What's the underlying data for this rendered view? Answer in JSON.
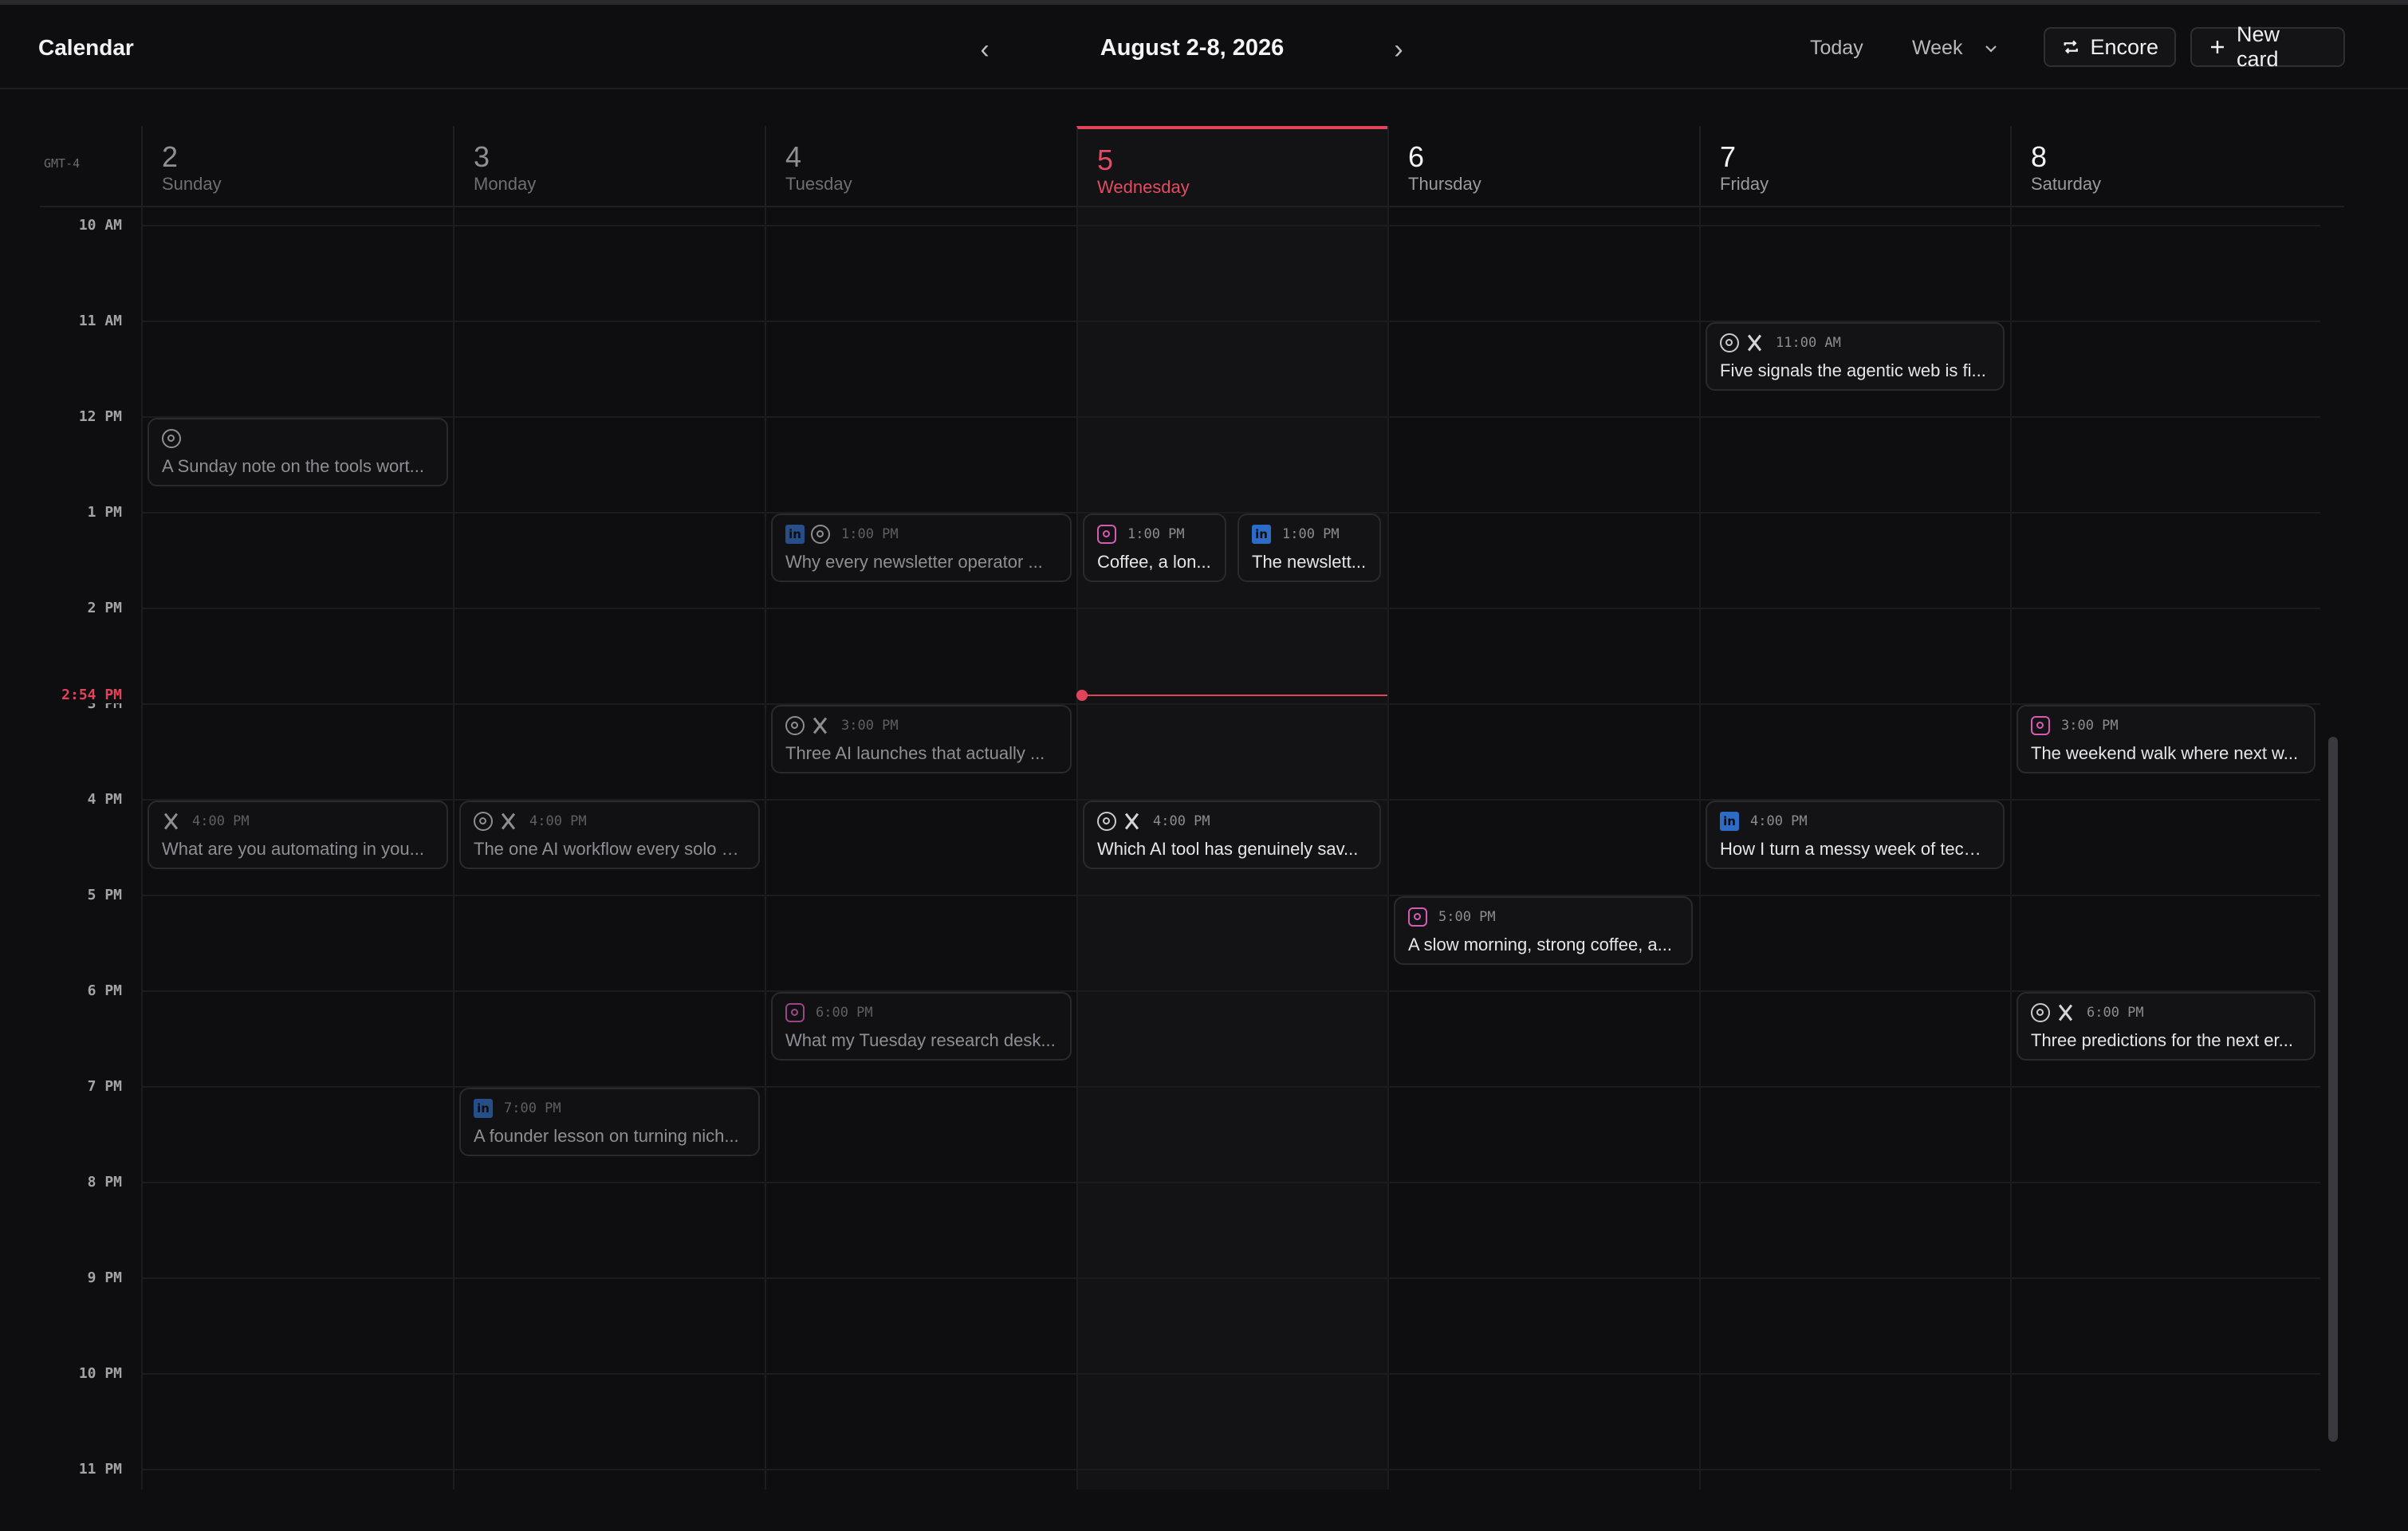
{
  "header": {
    "title": "Calendar",
    "range": "August 2-8, 2026",
    "prev_icon": "chevron-left-icon",
    "next_icon": "chevron-right-icon",
    "today_label": "Today",
    "view_label": "Week",
    "encore_label": "Encore",
    "new_card_label": "New card"
  },
  "timezone": "GMT-4",
  "days": [
    {
      "num": "2",
      "name": "Sunday"
    },
    {
      "num": "3",
      "name": "Monday"
    },
    {
      "num": "4",
      "name": "Tuesday"
    },
    {
      "num": "5",
      "name": "Wednesday"
    },
    {
      "num": "6",
      "name": "Thursday"
    },
    {
      "num": "7",
      "name": "Friday"
    },
    {
      "num": "8",
      "name": "Saturday"
    }
  ],
  "hours": [
    "10 AM",
    "11 AM",
    "12 PM",
    "1 PM",
    "2 PM",
    "3 PM",
    "4 PM",
    "5 PM",
    "6 PM",
    "7 PM",
    "8 PM",
    "9 PM",
    "10 PM",
    "11 PM"
  ],
  "now": "2:54 PM",
  "accent": "#e0435a",
  "events": [
    {
      "time": "",
      "title": "A Sunday note on the tools wort...",
      "platforms": [
        "threads"
      ]
    },
    {
      "time": "4:00 PM",
      "title": "What are you automating in you...",
      "platforms": [
        "x"
      ]
    },
    {
      "time": "4:00 PM",
      "title": "The one AI workflow every solo n...",
      "platforms": [
        "threads",
        "x"
      ]
    },
    {
      "time": "7:00 PM",
      "title": "A founder lesson on turning nich...",
      "platforms": [
        "linkedin"
      ]
    },
    {
      "time": "1:00 PM",
      "title": "Why every newsletter operator ...",
      "platforms": [
        "linkedin",
        "threads"
      ]
    },
    {
      "time": "3:00 PM",
      "title": "Three AI launches that actually ...",
      "platforms": [
        "threads",
        "x"
      ]
    },
    {
      "time": "6:00 PM",
      "title": "What my Tuesday research desk...",
      "platforms": [
        "instagram"
      ]
    },
    {
      "time": "1:00 PM",
      "title": "Coffee, a lon...",
      "platforms": [
        "instagram"
      ]
    },
    {
      "time": "1:00 PM",
      "title": "The newslett...",
      "platforms": [
        "linkedin"
      ]
    },
    {
      "time": "4:00 PM",
      "title": "Which AI tool has genuinely sav...",
      "platforms": [
        "threads",
        "x"
      ]
    },
    {
      "time": "5:00 PM",
      "title": "A slow morning, strong coffee, a...",
      "platforms": [
        "instagram"
      ]
    },
    {
      "time": "11:00 AM",
      "title": "Five signals the agentic web is fi...",
      "platforms": [
        "threads",
        "x"
      ]
    },
    {
      "time": "4:00 PM",
      "title": "How I turn a messy week of tech ...",
      "platforms": [
        "linkedin"
      ]
    },
    {
      "time": "3:00 PM",
      "title": "The weekend walk where next w...",
      "platforms": [
        "instagram"
      ]
    },
    {
      "time": "6:00 PM",
      "title": "Three predictions for the next er...",
      "platforms": [
        "threads",
        "x"
      ]
    }
  ]
}
